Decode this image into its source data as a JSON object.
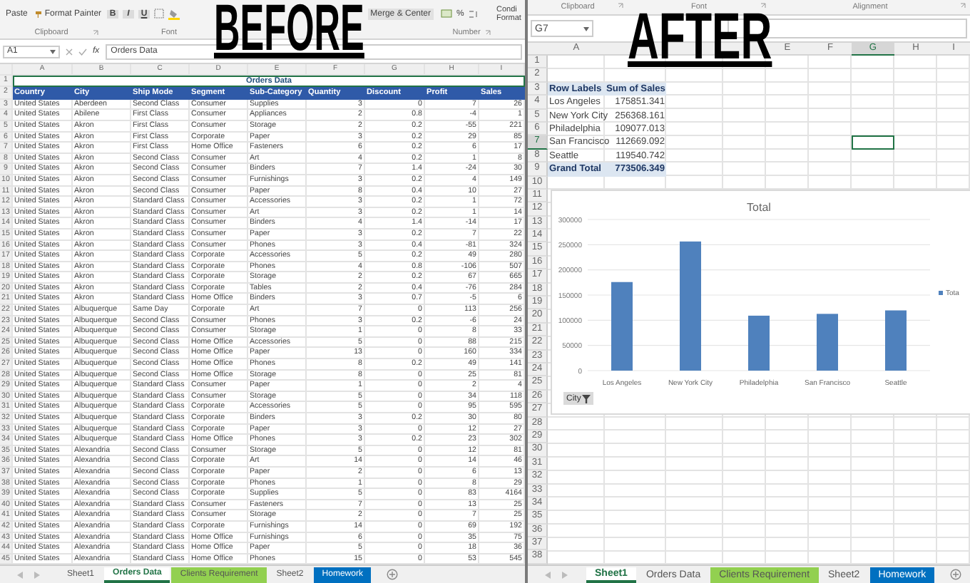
{
  "labels": {
    "before": "BEFORE",
    "after": "AFTER"
  },
  "left": {
    "ribbon": {
      "paste": "Paste",
      "format_painter": "Format Painter",
      "font_buttons": [
        "B",
        "I",
        "U"
      ],
      "merge": "Merge & Center",
      "number_buttons": [
        "%"
      ],
      "cut_labels": [
        "Condi",
        "Format"
      ],
      "groups": [
        "Clipboard",
        "Font",
        "Number"
      ]
    },
    "name_box": "A1",
    "function_label": "fx",
    "formula": "Orders Data",
    "columns": [
      "A",
      "B",
      "C",
      "D",
      "E",
      "F",
      "G",
      "H",
      "I"
    ],
    "title_row": {
      "num": "1",
      "text": "Orders Data"
    },
    "header_row": {
      "num": "2",
      "cells": [
        "Country",
        "City",
        "Ship Mode",
        "Segment",
        "Sub-Category",
        "Quantity",
        "Discount",
        "Profit",
        "Sales"
      ]
    },
    "rows": [
      {
        "num": "3",
        "cells": [
          "United States",
          "Aberdeen",
          "Second Class",
          "Consumer",
          "Supplies",
          "3",
          "0",
          "7",
          "26"
        ]
      },
      {
        "num": "4",
        "cells": [
          "United States",
          "Abilene",
          "First Class",
          "Consumer",
          "Appliances",
          "2",
          "0.8",
          "-4",
          "1"
        ]
      },
      {
        "num": "5",
        "cells": [
          "United States",
          "Akron",
          "First Class",
          "Consumer",
          "Storage",
          "2",
          "0.2",
          "-55",
          "221"
        ]
      },
      {
        "num": "6",
        "cells": [
          "United States",
          "Akron",
          "First Class",
          "Corporate",
          "Paper",
          "3",
          "0.2",
          "29",
          "85"
        ]
      },
      {
        "num": "7",
        "cells": [
          "United States",
          "Akron",
          "First Class",
          "Home Office",
          "Fasteners",
          "6",
          "0.2",
          "6",
          "17"
        ]
      },
      {
        "num": "8",
        "cells": [
          "United States",
          "Akron",
          "Second Class",
          "Consumer",
          "Art",
          "4",
          "0.2",
          "1",
          "8"
        ]
      },
      {
        "num": "9",
        "cells": [
          "United States",
          "Akron",
          "Second Class",
          "Consumer",
          "Binders",
          "7",
          "1.4",
          "-24",
          "30"
        ]
      },
      {
        "num": "10",
        "cells": [
          "United States",
          "Akron",
          "Second Class",
          "Consumer",
          "Furnishings",
          "3",
          "0.2",
          "4",
          "149"
        ]
      },
      {
        "num": "11",
        "cells": [
          "United States",
          "Akron",
          "Second Class",
          "Consumer",
          "Paper",
          "8",
          "0.4",
          "10",
          "27"
        ]
      },
      {
        "num": "12",
        "cells": [
          "United States",
          "Akron",
          "Standard Class",
          "Consumer",
          "Accessories",
          "3",
          "0.2",
          "1",
          "72"
        ]
      },
      {
        "num": "13",
        "cells": [
          "United States",
          "Akron",
          "Standard Class",
          "Consumer",
          "Art",
          "3",
          "0.2",
          "1",
          "14"
        ]
      },
      {
        "num": "14",
        "cells": [
          "United States",
          "Akron",
          "Standard Class",
          "Consumer",
          "Binders",
          "4",
          "1.4",
          "-14",
          "17"
        ]
      },
      {
        "num": "15",
        "cells": [
          "United States",
          "Akron",
          "Standard Class",
          "Consumer",
          "Paper",
          "3",
          "0.2",
          "7",
          "22"
        ]
      },
      {
        "num": "16",
        "cells": [
          "United States",
          "Akron",
          "Standard Class",
          "Consumer",
          "Phones",
          "3",
          "0.4",
          "-81",
          "324"
        ]
      },
      {
        "num": "17",
        "cells": [
          "United States",
          "Akron",
          "Standard Class",
          "Corporate",
          "Accessories",
          "5",
          "0.2",
          "49",
          "280"
        ]
      },
      {
        "num": "18",
        "cells": [
          "United States",
          "Akron",
          "Standard Class",
          "Corporate",
          "Phones",
          "4",
          "0.8",
          "-106",
          "507"
        ]
      },
      {
        "num": "19",
        "cells": [
          "United States",
          "Akron",
          "Standard Class",
          "Corporate",
          "Storage",
          "2",
          "0.2",
          "67",
          "665"
        ]
      },
      {
        "num": "20",
        "cells": [
          "United States",
          "Akron",
          "Standard Class",
          "Corporate",
          "Tables",
          "2",
          "0.4",
          "-76",
          "284"
        ]
      },
      {
        "num": "21",
        "cells": [
          "United States",
          "Akron",
          "Standard Class",
          "Home Office",
          "Binders",
          "3",
          "0.7",
          "-5",
          "6"
        ]
      },
      {
        "num": "22",
        "cells": [
          "United States",
          "Albuquerque",
          "Same Day",
          "Corporate",
          "Art",
          "7",
          "0",
          "113",
          "256"
        ]
      },
      {
        "num": "23",
        "cells": [
          "United States",
          "Albuquerque",
          "Second Class",
          "Consumer",
          "Phones",
          "3",
          "0.2",
          "-6",
          "24"
        ]
      },
      {
        "num": "24",
        "cells": [
          "United States",
          "Albuquerque",
          "Second Class",
          "Consumer",
          "Storage",
          "1",
          "0",
          "8",
          "33"
        ]
      },
      {
        "num": "25",
        "cells": [
          "United States",
          "Albuquerque",
          "Second Class",
          "Home Office",
          "Accessories",
          "5",
          "0",
          "88",
          "215"
        ]
      },
      {
        "num": "26",
        "cells": [
          "United States",
          "Albuquerque",
          "Second Class",
          "Home Office",
          "Paper",
          "13",
          "0",
          "160",
          "334"
        ]
      },
      {
        "num": "27",
        "cells": [
          "United States",
          "Albuquerque",
          "Second Class",
          "Home Office",
          "Phones",
          "8",
          "0.2",
          "49",
          "141"
        ]
      },
      {
        "num": "28",
        "cells": [
          "United States",
          "Albuquerque",
          "Second Class",
          "Home Office",
          "Storage",
          "8",
          "0",
          "25",
          "81"
        ]
      },
      {
        "num": "29",
        "cells": [
          "United States",
          "Albuquerque",
          "Standard Class",
          "Consumer",
          "Paper",
          "1",
          "0",
          "2",
          "4"
        ]
      },
      {
        "num": "30",
        "cells": [
          "United States",
          "Albuquerque",
          "Standard Class",
          "Consumer",
          "Storage",
          "5",
          "0",
          "34",
          "118"
        ]
      },
      {
        "num": "31",
        "cells": [
          "United States",
          "Albuquerque",
          "Standard Class",
          "Corporate",
          "Accessories",
          "5",
          "0",
          "95",
          "595"
        ]
      },
      {
        "num": "32",
        "cells": [
          "United States",
          "Albuquerque",
          "Standard Class",
          "Corporate",
          "Binders",
          "3",
          "0.2",
          "30",
          "80"
        ]
      },
      {
        "num": "33",
        "cells": [
          "United States",
          "Albuquerque",
          "Standard Class",
          "Corporate",
          "Paper",
          "3",
          "0",
          "12",
          "27"
        ]
      },
      {
        "num": "34",
        "cells": [
          "United States",
          "Albuquerque",
          "Standard Class",
          "Home Office",
          "Phones",
          "3",
          "0.2",
          "23",
          "302"
        ]
      },
      {
        "num": "35",
        "cells": [
          "United States",
          "Alexandria",
          "Second Class",
          "Consumer",
          "Storage",
          "5",
          "0",
          "12",
          "81"
        ]
      },
      {
        "num": "36",
        "cells": [
          "United States",
          "Alexandria",
          "Second Class",
          "Corporate",
          "Art",
          "14",
          "0",
          "14",
          "46"
        ]
      },
      {
        "num": "37",
        "cells": [
          "United States",
          "Alexandria",
          "Second Class",
          "Corporate",
          "Paper",
          "2",
          "0",
          "6",
          "13"
        ]
      },
      {
        "num": "38",
        "cells": [
          "United States",
          "Alexandria",
          "Second Class",
          "Corporate",
          "Phones",
          "1",
          "0",
          "8",
          "29"
        ]
      },
      {
        "num": "39",
        "cells": [
          "United States",
          "Alexandria",
          "Second Class",
          "Corporate",
          "Supplies",
          "5",
          "0",
          "83",
          "4164"
        ]
      },
      {
        "num": "40",
        "cells": [
          "United States",
          "Alexandria",
          "Standard Class",
          "Consumer",
          "Fasteners",
          "7",
          "0",
          "13",
          "25"
        ]
      },
      {
        "num": "41",
        "cells": [
          "United States",
          "Alexandria",
          "Standard Class",
          "Consumer",
          "Storage",
          "2",
          "0",
          "7",
          "25"
        ]
      },
      {
        "num": "42",
        "cells": [
          "United States",
          "Alexandria",
          "Standard Class",
          "Corporate",
          "Furnishings",
          "14",
          "0",
          "69",
          "192"
        ]
      },
      {
        "num": "43",
        "cells": [
          "United States",
          "Alexandria",
          "Standard Class",
          "Home Office",
          "Furnishings",
          "6",
          "0",
          "35",
          "75"
        ]
      },
      {
        "num": "44",
        "cells": [
          "United States",
          "Alexandria",
          "Standard Class",
          "Home Office",
          "Paper",
          "5",
          "0",
          "18",
          "36"
        ]
      },
      {
        "num": "45",
        "cells": [
          "United States",
          "Alexandria",
          "Standard Class",
          "Home Office",
          "Phones",
          "15",
          "0",
          "53",
          "545"
        ]
      }
    ],
    "tabs": [
      {
        "label": "Sheet1",
        "selected": false
      },
      {
        "label": "Orders Data",
        "selected": true
      },
      {
        "label": "Clients Requirement",
        "selected": false,
        "color": "#92d050"
      },
      {
        "label": "Sheet2",
        "selected": false
      },
      {
        "label": "Homework",
        "selected": false,
        "color": "#0070c0"
      }
    ]
  },
  "right": {
    "ribbon_groups": [
      "Clipboard",
      "Font",
      "Alignment"
    ],
    "name_box": "G7",
    "columns": [
      {
        "label": "A",
        "selected": false
      },
      {
        "selected": false
      },
      {
        "selected": false
      },
      {
        "selected": false
      },
      {
        "label": "E",
        "selected": false
      },
      {
        "label": "F",
        "selected": false
      },
      {
        "label": "G",
        "selected": true
      },
      {
        "label": "H",
        "selected": false
      },
      {
        "label": "I",
        "selected": false
      }
    ],
    "rows": [
      {
        "label": "1",
        "selected": false
      },
      {
        "label": "2",
        "selected": false
      },
      {
        "label": "3",
        "selected": false
      },
      {
        "label": "4",
        "selected": false
      },
      {
        "label": "5",
        "selected": false
      },
      {
        "label": "6",
        "selected": false
      },
      {
        "label": "7",
        "selected": true
      },
      {
        "label": "8",
        "selected": false
      },
      {
        "label": "9",
        "selected": false
      },
      {
        "label": "10",
        "selected": false
      },
      {
        "label": "11",
        "selected": false
      },
      {
        "label": "12",
        "selected": false
      },
      {
        "label": "13",
        "selected": false
      },
      {
        "label": "14",
        "selected": false
      },
      {
        "label": "15",
        "selected": false
      },
      {
        "label": "16",
        "selected": false
      },
      {
        "label": "17",
        "selected": false
      },
      {
        "label": "18",
        "selected": false
      },
      {
        "label": "19",
        "selected": false
      },
      {
        "label": "20",
        "selected": false
      },
      {
        "label": "21",
        "selected": false
      },
      {
        "label": "22",
        "selected": false
      },
      {
        "label": "23",
        "selected": false
      },
      {
        "label": "24",
        "selected": false
      },
      {
        "label": "25",
        "selected": false
      },
      {
        "label": "26",
        "selected": false
      },
      {
        "label": "27",
        "selected": false
      },
      {
        "label": "28",
        "selected": false
      },
      {
        "label": "29",
        "selected": false
      },
      {
        "label": "30",
        "selected": false
      },
      {
        "label": "31",
        "selected": false
      },
      {
        "label": "32",
        "selected": false
      },
      {
        "label": "33",
        "selected": false
      },
      {
        "label": "34",
        "selected": false
      },
      {
        "label": "35",
        "selected": false
      },
      {
        "label": "36",
        "selected": false
      },
      {
        "label": "37",
        "selected": false
      },
      {
        "label": "38",
        "selected": false
      }
    ],
    "pivot": {
      "headers": [
        "Row Labels",
        "Sum of Sales"
      ],
      "rows": [
        [
          "Los Angeles",
          "175851.341"
        ],
        [
          "New York City",
          "256368.161"
        ],
        [
          "Philadelphia",
          "109077.013"
        ],
        [
          "San Francisco",
          "112669.092"
        ],
        [
          "Seattle",
          "119540.742"
        ]
      ],
      "total": [
        "Grand Total",
        "773506.349"
      ]
    },
    "chart": {
      "filter_button": "City",
      "chart_data": {
        "type": "bar",
        "title": "Total",
        "categories": [
          "Los Angeles",
          "New York City",
          "Philadelphia",
          "San Francisco",
          "Seattle"
        ],
        "series": [
          {
            "name": "Tota",
            "color": "#4f81bd",
            "values": [
              175851.341,
              256368.161,
              109077.013,
              112669.092,
              119540.742
            ]
          }
        ],
        "grid": true,
        "ylim": [
          0,
          300000
        ],
        "yticks": [
          0,
          50000,
          100000,
          150000,
          200000,
          250000,
          300000
        ]
      }
    },
    "tabs": [
      {
        "label": "Sheet1",
        "selected": true
      },
      {
        "label": "Orders Data",
        "selected": false
      },
      {
        "label": "Clients Requirement",
        "selected": false,
        "color": "#92d050"
      },
      {
        "label": "Sheet2",
        "selected": false
      },
      {
        "label": "Homework",
        "selected": false,
        "color": "#0070c0"
      }
    ]
  }
}
